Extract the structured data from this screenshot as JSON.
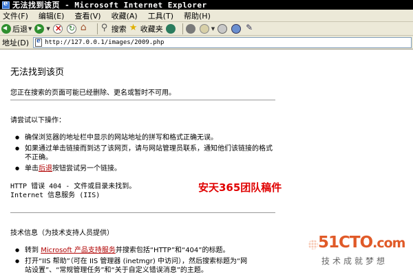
{
  "window": {
    "title": "无法找到该页 - Microsoft Internet Explorer"
  },
  "menu": {
    "items": [
      "文件(F)",
      "编辑(E)",
      "查看(V)",
      "收藏(A)",
      "工具(T)",
      "帮助(H)"
    ]
  },
  "toolbar": {
    "back_label": "后退",
    "search_label": "搜索",
    "favorites_label": "收藏夹"
  },
  "address": {
    "label": "地址(D)",
    "url": "http://127.0.0.1/images/2009.php"
  },
  "page": {
    "title": "无法找到该页",
    "intro": "您正在搜索的页面可能已经删除、更名或暂时不可用。",
    "try_heading": "请尝试以下操作：",
    "try_items": [
      {
        "line1": "确保浏览器的地址栏中显示的网站地址的拼写和格式正确无误。"
      },
      {
        "line1": "如果通过单击链接而到达了该网页，请与网站管理员联系，通知他们该链接的格式",
        "line2": "不正确。"
      },
      {
        "pre": "单击",
        "link": "后退",
        "post": "按钮尝试另一个链接。"
      }
    ],
    "error_line1": "HTTP 错误 404 - 文件或目录未找到。",
    "error_line2": "Internet 信息服务 (IIS)",
    "tech_heading": "技术信息（为技术支持人员提供）",
    "tech_items": [
      {
        "pre": "转到 ",
        "link": "Microsoft 产品支持服务",
        "post": "并搜索包括“HTTP”和“404”的标题。"
      },
      {
        "line1": "打开“IIS 帮助”（可在 IIS 管理器 (inetmgr) 中访问），然后搜索标题为“网",
        "line2": "站设置”、“常规管理任务”和“关于自定义错误消息”的主题。"
      }
    ]
  },
  "watermark": {
    "text": "安天365团队稿件",
    "color": "#e00000"
  },
  "logo": {
    "brand_main": "51CTO",
    "brand_suffix": ".com",
    "slogan": "技术成就梦想",
    "color": "#e05a28"
  }
}
